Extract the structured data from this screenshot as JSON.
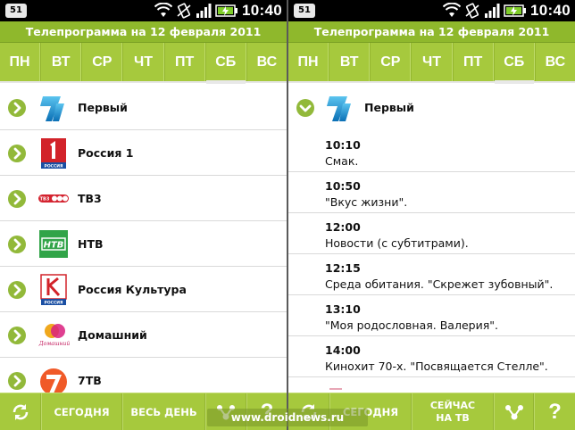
{
  "colors": {
    "accent": "#a6c93d",
    "title_bar": "#8fb82c",
    "status_bar": "#000000",
    "list_bg": "#ffffff"
  },
  "status_bar": {
    "notification": "51",
    "time": "10:40",
    "icons": [
      "wifi-icon",
      "vibrate-icon",
      "signal-icon",
      "battery-charging-icon"
    ]
  },
  "title": "Телепрограмма на 12 февраля 2011",
  "days": [
    "ПН",
    "ВТ",
    "СР",
    "ЧТ",
    "ПТ",
    "СБ",
    "ВС"
  ],
  "active_day": "СБ",
  "left": {
    "channels": [
      {
        "name": "Первый",
        "logo": "perviy-logo-icon"
      },
      {
        "name": "Россия 1",
        "logo": "rossiya1-logo-icon",
        "logo_text": "РОССИЯ"
      },
      {
        "name": "ТВ3",
        "logo": "tv3-logo-icon",
        "logo_text": "ТВ3"
      },
      {
        "name": "НТВ",
        "logo": "ntv-logo-icon",
        "logo_text": "НТВ"
      },
      {
        "name": "Россия Культура",
        "logo": "kultura-logo-icon",
        "logo_text": "РОССИЯ"
      },
      {
        "name": "Домашний",
        "logo": "domashniy-logo-icon",
        "logo_text": "Домашний"
      },
      {
        "name": "7ТВ",
        "logo": "7tv-logo-icon"
      }
    ],
    "bottom": {
      "today": "СЕГОДНЯ",
      "all_day": "ВЕСЬ ДЕНЬ",
      "help": "?"
    }
  },
  "right": {
    "channel": {
      "name": "Первый",
      "logo": "perviy-logo-icon"
    },
    "programs": [
      {
        "time": "10:10",
        "title": "Смак."
      },
      {
        "time": "10:50",
        "title": "\"Вкус жизни\"."
      },
      {
        "time": "12:00",
        "title": "Новости (с субтитрами)."
      },
      {
        "time": "12:15",
        "title": "Среда обитания. \"Скрежет зубовный\"."
      },
      {
        "time": "13:10",
        "title": "\"Моя родословная. Валерия\"."
      },
      {
        "time": "14:00",
        "title": "Кинохит 70-х. \"Посвящается Стелле\"."
      }
    ],
    "bottom": {
      "today": "СЕГОДНЯ",
      "now_line1": "СЕЙЧАС",
      "now_line2": "НА ТВ",
      "help": "?"
    }
  },
  "watermark": "www.droidnews.ru"
}
